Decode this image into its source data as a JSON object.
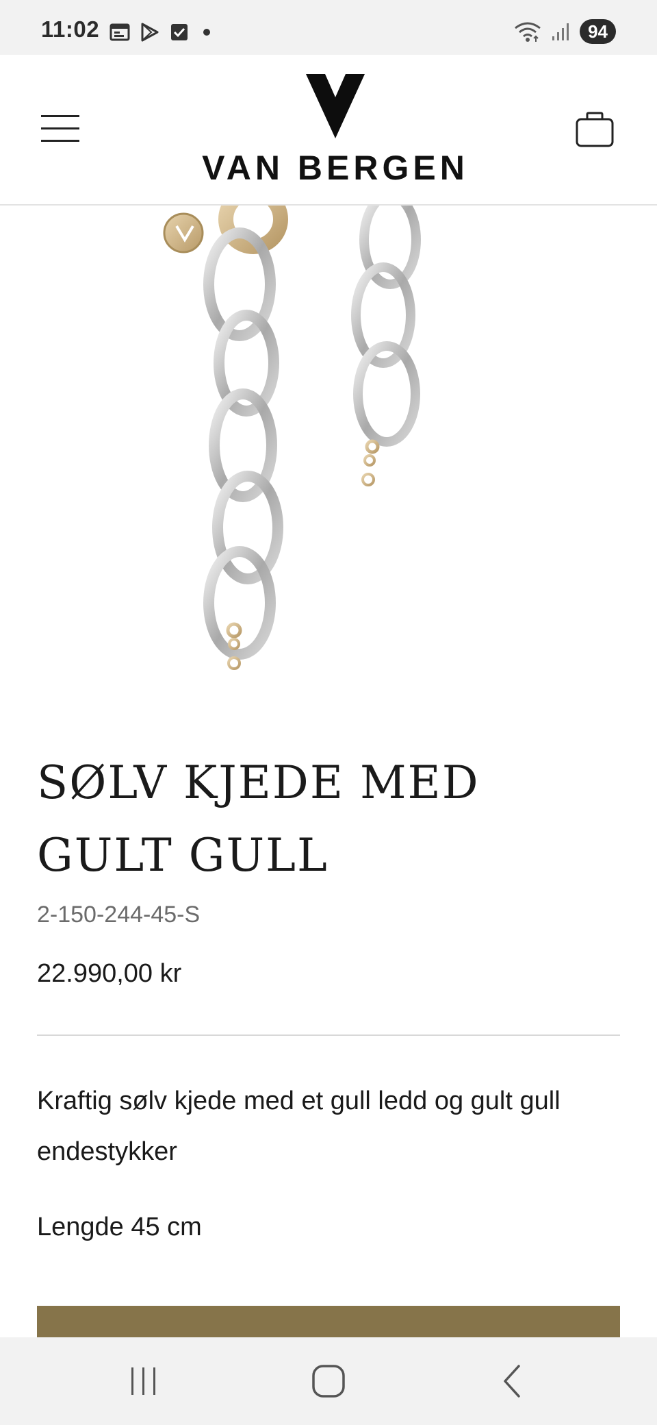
{
  "status_bar": {
    "time": "11:02",
    "battery": "94",
    "left_icons": [
      "calendar-icon",
      "play-store-icon",
      "checkbox-icon",
      "dot-icon"
    ],
    "right_icons": [
      "wifi-icon",
      "signal-icon"
    ]
  },
  "header": {
    "brand": "VAN BERGEN",
    "menu_icon": "hamburger-menu-icon",
    "cart_icon": "shopping-bag-icon"
  },
  "product": {
    "image_alt_name": "product-image",
    "title_line1": "SØLV KJEDE MED",
    "title_line2": "GULT GULL",
    "sku": "2-150-244-45-S",
    "price": "22.990,00 kr",
    "description": "Kraftig sølv kjede med et gull ledd og gult gull endestykker",
    "length": "Lengde 45 cm",
    "accent_color": "#86744a"
  },
  "nav_bar": {
    "buttons": [
      "recent-apps-icon",
      "home-icon",
      "back-icon"
    ]
  }
}
